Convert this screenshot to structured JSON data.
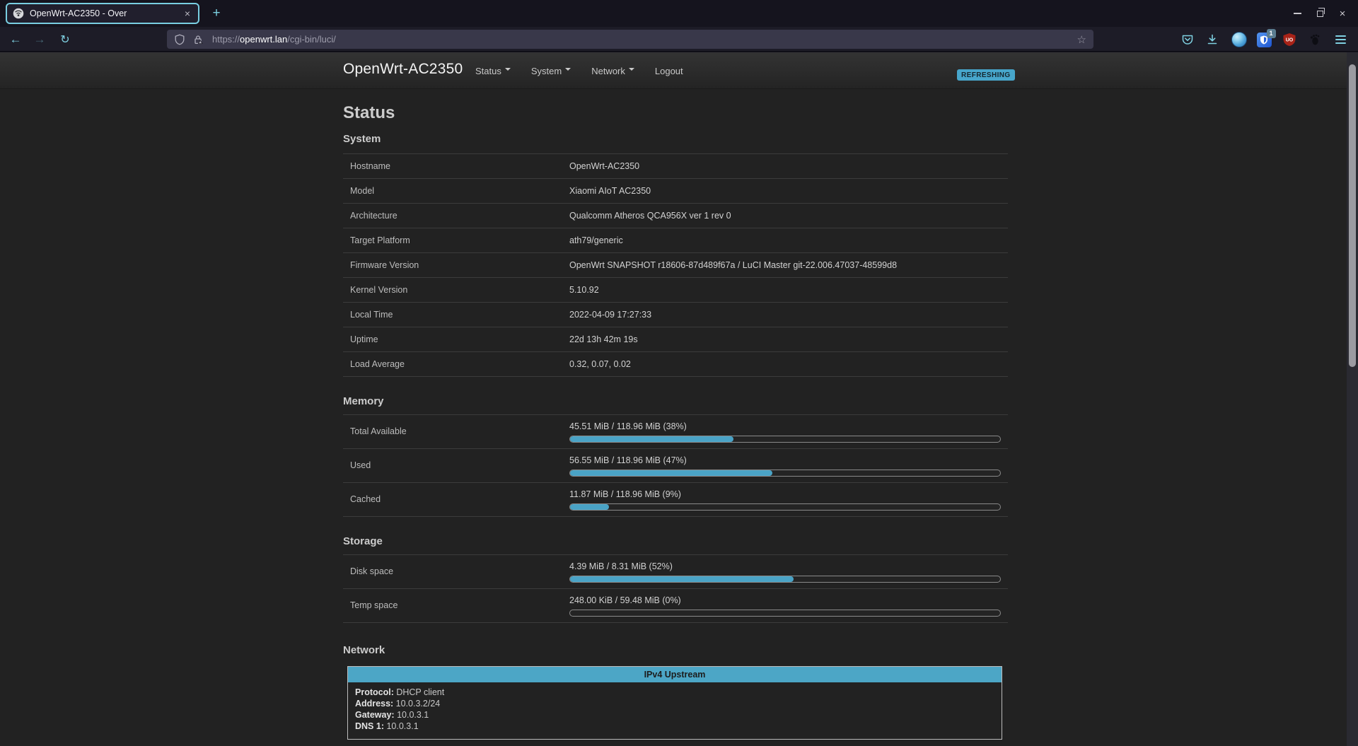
{
  "browser": {
    "tab_title": "OpenWrt-AC2350 - Over",
    "icons": {
      "tab_close": "×",
      "new_tab": "+",
      "back": "←",
      "forward": "→",
      "reload": "↻",
      "star": "☆",
      "window_close": "×"
    },
    "url": {
      "prefix": "https://",
      "domain": "openwrt.lan",
      "path": "/cgi-bin/luci/"
    },
    "extensions": {
      "bitwarden_badge": "1",
      "ublock_label": "UO"
    }
  },
  "header": {
    "brand": "OpenWrt-AC2350",
    "nav": [
      {
        "label": "Status"
      },
      {
        "label": "System"
      },
      {
        "label": "Network"
      },
      {
        "label": "Logout"
      }
    ],
    "refresh_badge": "REFRESHING"
  },
  "page": {
    "title": "Status",
    "system": {
      "heading": "System",
      "rows": [
        {
          "label": "Hostname",
          "value": "OpenWrt-AC2350"
        },
        {
          "label": "Model",
          "value": "Xiaomi AIoT AC2350"
        },
        {
          "label": "Architecture",
          "value": "Qualcomm Atheros QCA956X ver 1 rev 0"
        },
        {
          "label": "Target Platform",
          "value": "ath79/generic"
        },
        {
          "label": "Firmware Version",
          "value": "OpenWrt SNAPSHOT r18606-87d489f67a / LuCI Master git-22.006.47037-48599d8"
        },
        {
          "label": "Kernel Version",
          "value": "5.10.92"
        },
        {
          "label": "Local Time",
          "value": "2022-04-09 17:27:33"
        },
        {
          "label": "Uptime",
          "value": "22d 13h 42m 19s"
        },
        {
          "label": "Load Average",
          "value": "0.32, 0.07, 0.02"
        }
      ]
    },
    "memory": {
      "heading": "Memory",
      "rows": [
        {
          "label": "Total Available",
          "value": "45.51 MiB / 118.96 MiB (38%)",
          "percent": 38
        },
        {
          "label": "Used",
          "value": "56.55 MiB / 118.96 MiB (47%)",
          "percent": 47
        },
        {
          "label": "Cached",
          "value": "11.87 MiB / 118.96 MiB (9%)",
          "percent": 9
        }
      ]
    },
    "storage": {
      "heading": "Storage",
      "rows": [
        {
          "label": "Disk space",
          "value": "4.39 MiB / 8.31 MiB (52%)",
          "percent": 52
        },
        {
          "label": "Temp space",
          "value": "248.00 KiB / 59.48 MiB (0%)",
          "percent": 0
        }
      ]
    },
    "network": {
      "heading": "Network",
      "table_header": "IPv4 Upstream",
      "fields": [
        {
          "label": "Protocol:",
          "value": "DHCP client"
        },
        {
          "label": "Address:",
          "value": "10.0.3.2/24"
        },
        {
          "label": "Gateway:",
          "value": "10.0.3.1"
        },
        {
          "label": "DNS 1:",
          "value": "10.0.3.1"
        }
      ]
    },
    "colors": {
      "accent": "#4aa3c6"
    }
  }
}
